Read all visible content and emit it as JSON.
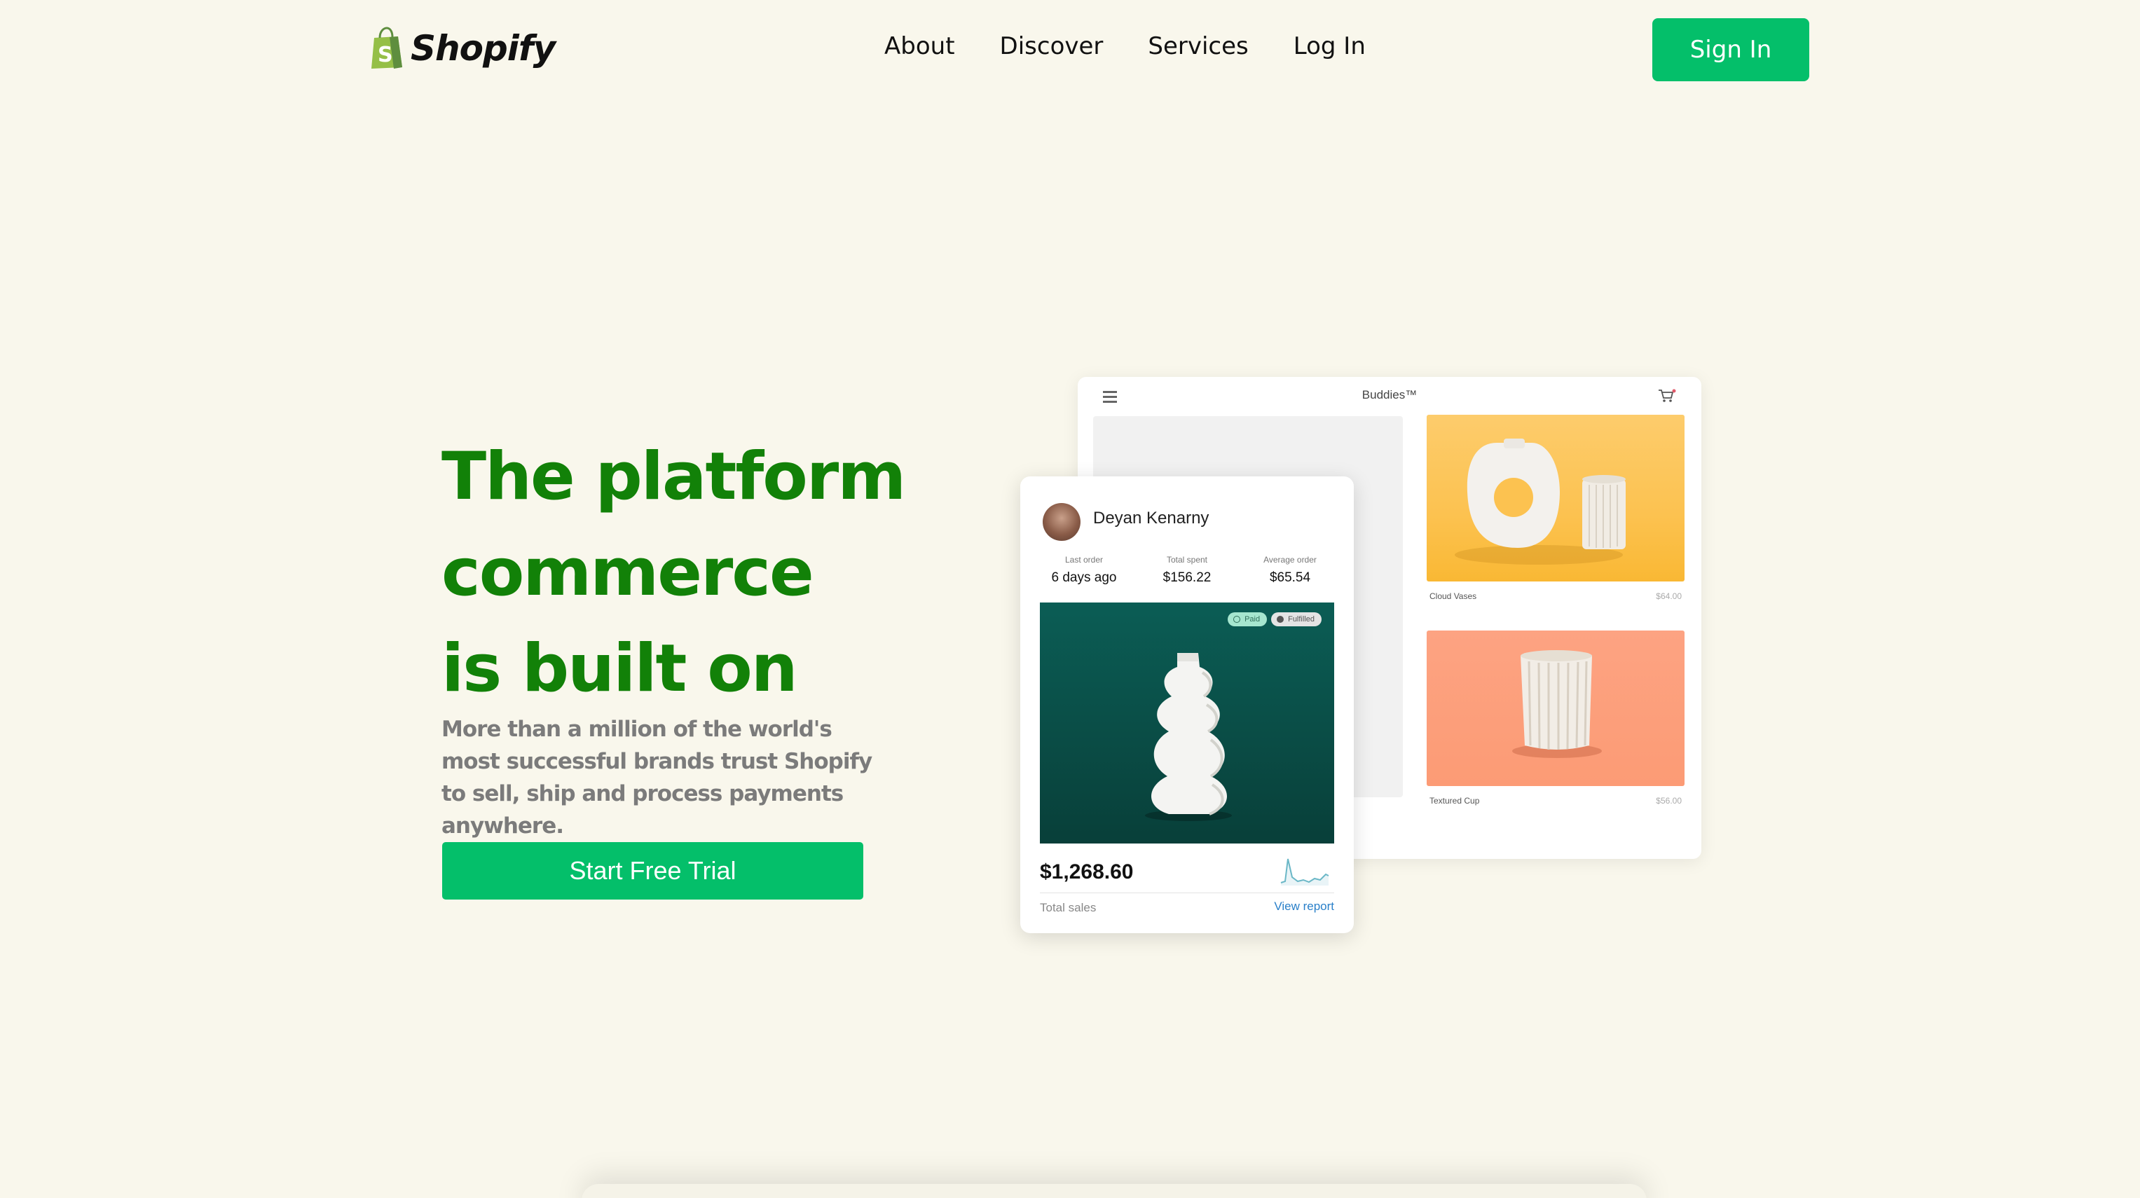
{
  "header": {
    "brand": "Shopify",
    "nav": [
      "About",
      "Discover",
      "Services",
      "Log In"
    ],
    "signin_label": "Sign In"
  },
  "hero": {
    "title_lines": [
      "The platform",
      "commerce",
      "is built on"
    ],
    "subtitle": "More than a million of the world's most successful brands trust Shopify to sell, ship and process payments anywhere.",
    "cta_label": "Start Free Trial"
  },
  "storefront": {
    "title": "Buddies™",
    "products": [
      {
        "name": "Cloud Vases",
        "price": "$64.00"
      },
      {
        "name": "Textured Cup",
        "price": "$56.00"
      }
    ]
  },
  "customer_card": {
    "name": "Deyan Kenarny",
    "stats": [
      {
        "label": "Last order",
        "value": "6 days ago"
      },
      {
        "label": "Total spent",
        "value": "$156.22"
      },
      {
        "label": "Average order",
        "value": "$65.54"
      }
    ],
    "badges": [
      "Paid",
      "Fulfilled"
    ],
    "total_amount": "$1,268.60",
    "total_label": "Total sales",
    "view_report": "View report"
  },
  "colors": {
    "background": "#f9f7ec",
    "brand_green": "#04bf6a",
    "heading_green": "#128108",
    "subtitle_gray": "#7b7b7b",
    "photo_teal": "#0a4d46",
    "card_yellow": "#fcc250",
    "card_peach": "#fc9b75"
  },
  "icons": [
    "shopify-bag-icon",
    "hamburger-menu-icon",
    "cart-icon",
    "sparkline-chart-icon"
  ]
}
